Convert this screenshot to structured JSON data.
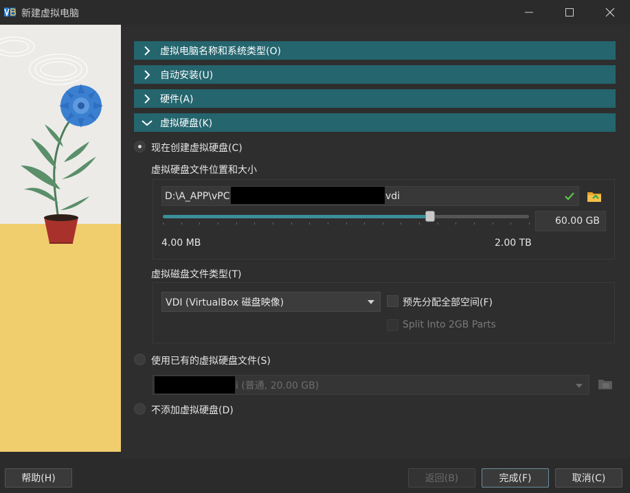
{
  "window": {
    "title": "新建虚拟电脑"
  },
  "sections": [
    {
      "label": "虚拟电脑名称和系统类型(O)",
      "expanded": false
    },
    {
      "label": "自动安装(U)",
      "expanded": false
    },
    {
      "label": "硬件(A)",
      "expanded": false
    },
    {
      "label": "虚拟硬盘(K)",
      "expanded": true
    }
  ],
  "disk": {
    "create_now_label": "现在创建虚拟硬盘(C)",
    "location_size_label": "虚拟硬盘文件位置和大小",
    "path_prefix": "D:\\A_APP\\vPC",
    "path_suffix": "vdi",
    "size_value": "60.00 GB",
    "size_fraction": 0.73,
    "min_label": "4.00 MB",
    "max_label": "2.00 TB",
    "file_type_label": "虚拟磁盘文件类型(T)",
    "file_type_selected": "VDI (VirtualBox 磁盘映像)",
    "preallocate_label": "预先分配全部空间(F)",
    "split_label": "Split Into 2GB Parts",
    "use_existing_label": "使用已有的虚拟硬盘文件(S)",
    "existing_value_suffix": "i (普通, 20.00 GB)",
    "no_disk_label": "不添加虚拟硬盘(D)"
  },
  "buttons": {
    "help": "帮助(H)",
    "back": "返回(B)",
    "finish": "完成(F)",
    "cancel": "取消(C)"
  },
  "colors": {
    "section_bg": "#24656e",
    "accent": "#3a8f9a"
  }
}
